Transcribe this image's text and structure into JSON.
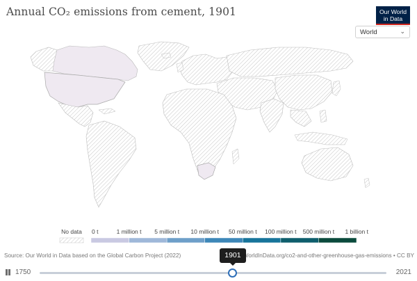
{
  "header": {
    "title": "Annual CO₂ emissions from cement, 1901",
    "logo_line1": "Our World",
    "logo_line2": "in Data"
  },
  "controls": {
    "region_value": "World"
  },
  "legend": {
    "no_data_label": "No data",
    "bins": [
      "0 t",
      "1 million t",
      "5 million t",
      "10 million t",
      "50 million t",
      "100 million t",
      "500 million t",
      "1 billion t"
    ],
    "colors": [
      "#e9e7f0",
      "#c9c9e2",
      "#9fb8d9",
      "#6e9fc9",
      "#3d87b8",
      "#17749a",
      "#0e5e6c",
      "#0a4a3c"
    ]
  },
  "colors": {
    "data_country_fill": "#efe9f1",
    "no_data_stroke": "#c5c5c5",
    "accent": "#2e6fb8"
  },
  "footer": {
    "source": "Source: Our World in Data based on the Global Carbon Project (2022)",
    "license": "OurWorldInData.org/co2-and-other-greenhouse-gas-emissions • CC BY"
  },
  "timeline": {
    "start_year": "1750",
    "end_year": "2021",
    "current_year": "1901",
    "progress": 0.557
  },
  "map_data": {
    "countries_with_data": [
      "United States",
      "Canada",
      "South Africa"
    ]
  }
}
